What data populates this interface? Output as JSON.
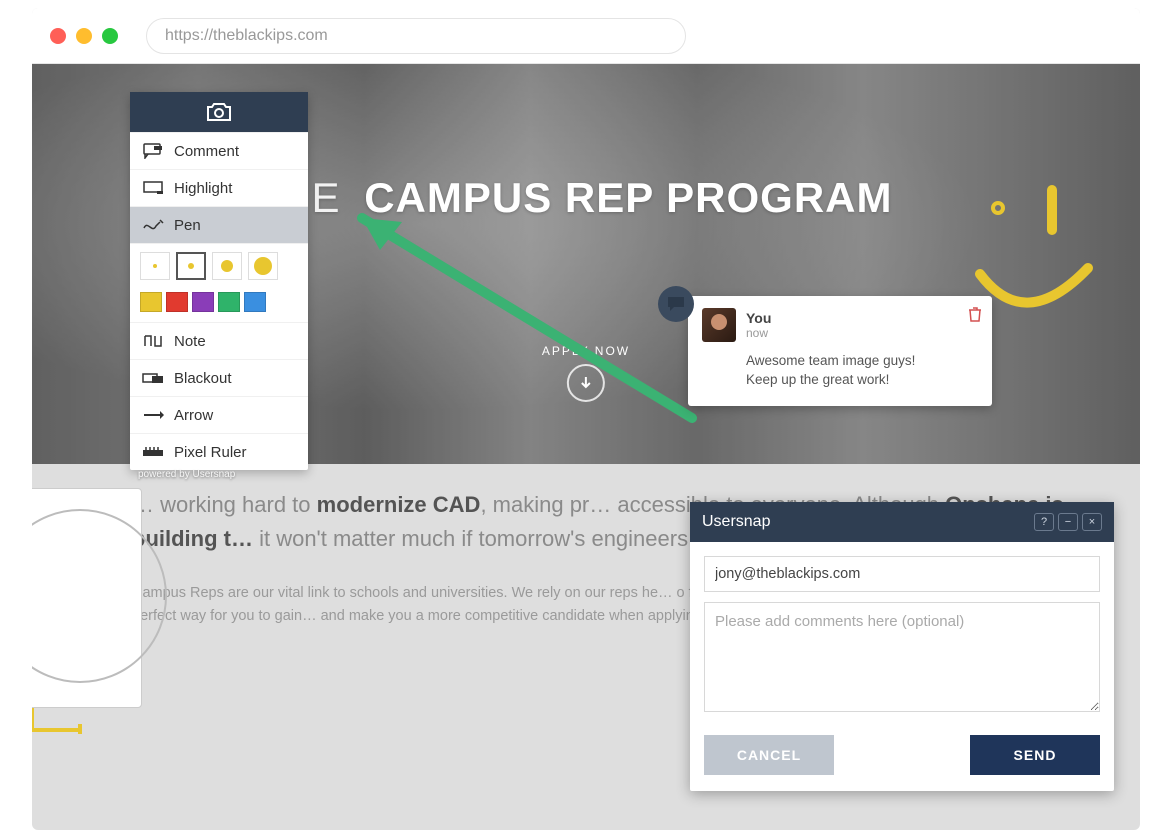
{
  "browser": {
    "url": "https://theblackips.com"
  },
  "hero": {
    "title_prefix": "PE",
    "title_main": "CAMPUS REP PROGRAM",
    "apply_label": "APPLY NOW"
  },
  "body": {
    "lead_prefix": "… working hard to ",
    "lead_bold1": "modernize CAD",
    "lead_mid": ", making pr… accessible to everyone. Although ",
    "lead_bold2": "Onshape is building t…",
    "lead_suffix": " it won't matter much if tomorrow's engineers and designe… e in!",
    "small": "Campus Reps are our vital link to schools and universities. We rely on our reps he… o free professional CAD. Becoming a Campus Rep is the perfect way for you to gain… and make you a more competitive candidate when applying for jobs."
  },
  "toolbar": {
    "powered": "powered by Usersnap",
    "items": {
      "comment": "Comment",
      "highlight": "Highlight",
      "pen": "Pen",
      "note": "Note",
      "blackout": "Blackout",
      "arrow": "Arrow",
      "pixel_ruler": "Pixel Ruler"
    },
    "pen_sizes": [
      4,
      6,
      12,
      18
    ],
    "pen_size_selected_index": 1,
    "colors": [
      "#e8c62f",
      "#e13a2f",
      "#8a3db8",
      "#2fb36a",
      "#3a8fe0"
    ],
    "selected_tool": "pen"
  },
  "comment": {
    "author": "You",
    "time": "now",
    "text_line1": "Awesome team image guys!",
    "text_line2": "Keep up the great work!"
  },
  "dialog": {
    "title": "Usersnap",
    "email": "jony@theblackips.com",
    "comments_placeholder": "Please add comments here (optional)",
    "cancel": "CANCEL",
    "send": "SEND",
    "winbtns": {
      "help": "?",
      "min": "−",
      "close": "×"
    }
  }
}
